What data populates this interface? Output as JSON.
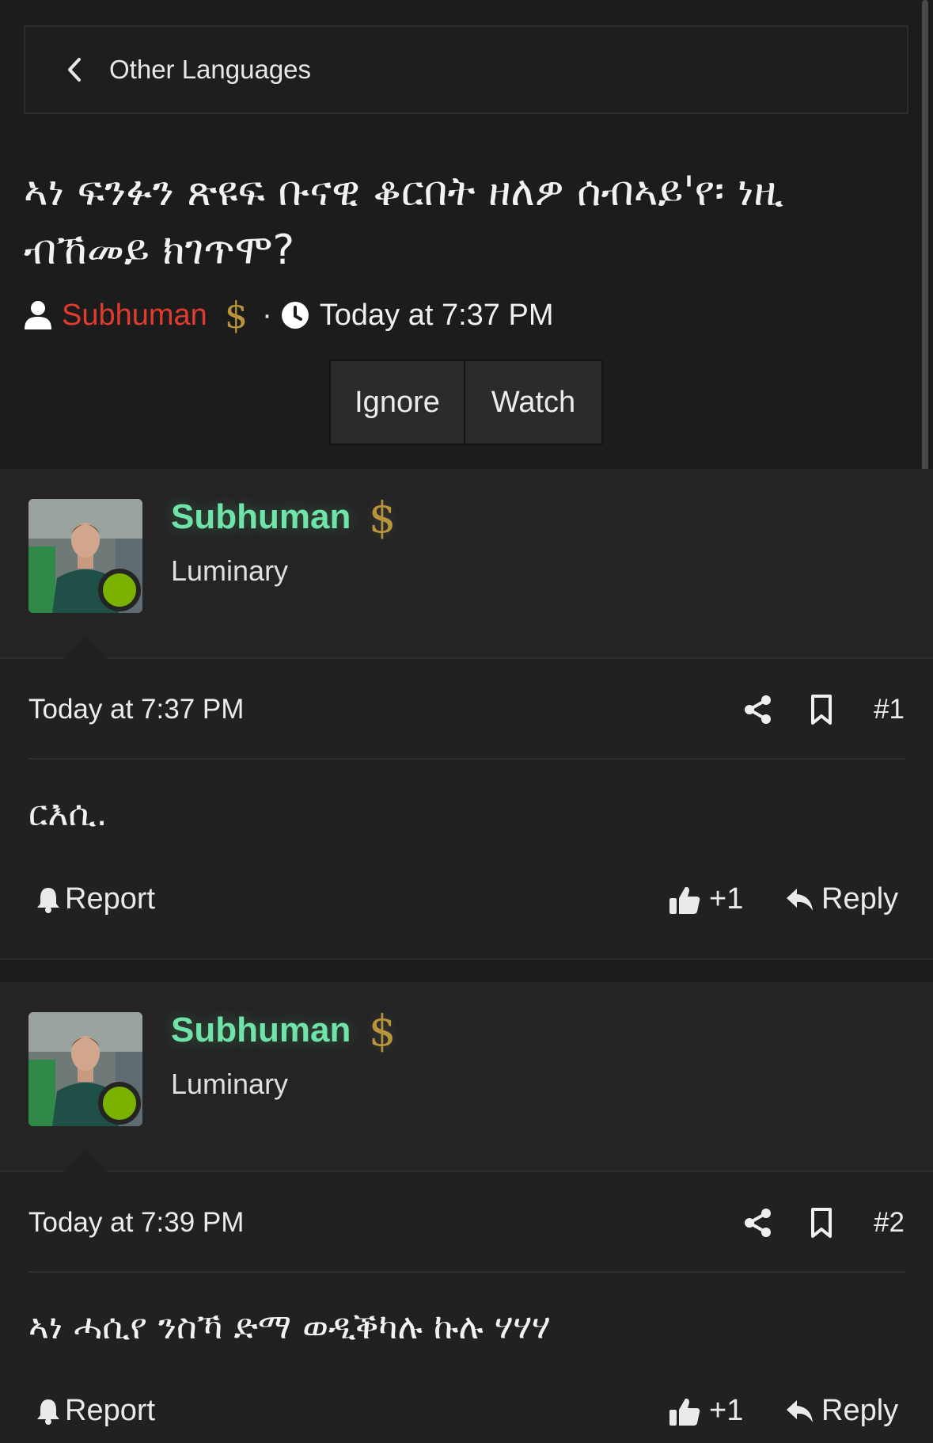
{
  "breadcrumb": {
    "label": "Other Languages"
  },
  "thread": {
    "title": "ኣነ ፍንፉን ጽዩፍ ቡናዊ ቆርበት ዘለዎ ሰብኣይ'የ፡ ነዚ ብኸመይ ክገጥሞ?",
    "author": "Subhuman",
    "dollar": "$",
    "separator": "·",
    "time": "Today at 7:37 PM",
    "buttons": {
      "ignore": "Ignore",
      "watch": "Watch"
    }
  },
  "posts": [
    {
      "username": "Subhuman",
      "dollar": "$",
      "user_title": "Luminary",
      "time": "Today at 7:37 PM",
      "number": "#1",
      "body": "ርእሲ.",
      "report": "Report",
      "likes": "+1",
      "reply": "Reply"
    },
    {
      "username": "Subhuman",
      "dollar": "$",
      "user_title": "Luminary",
      "time": "Today at 7:39 PM",
      "number": "#2",
      "body": "ኣነ ሓሲየ ንስኻ ድማ ወዲቕካሉ ኩሉ ሃሃሃ",
      "report": "Report",
      "likes": "+1",
      "reply": "Reply"
    }
  ],
  "colors": {
    "background": "#1c1c1c",
    "author_red": "#e03b2c",
    "username_green": "#6fe3a8",
    "dollar_gold": "#b8953a",
    "online_green": "#7bb200"
  },
  "icons": [
    "chevron-left-icon",
    "user-icon",
    "clock-icon",
    "share-icon",
    "bookmark-icon",
    "bell-icon",
    "thumbs-up-icon",
    "reply-icon",
    "dollar-icon"
  ]
}
